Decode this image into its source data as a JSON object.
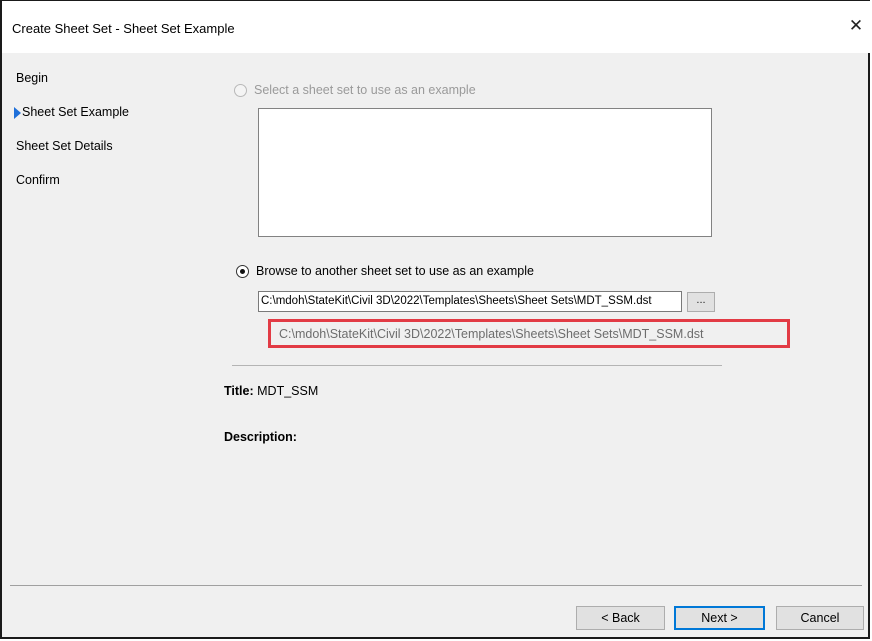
{
  "window": {
    "title": "Create Sheet Set - Sheet Set Example",
    "close_glyph": "✕"
  },
  "steps": [
    {
      "label": "Begin",
      "current": false
    },
    {
      "label": "Sheet Set Example",
      "current": true
    },
    {
      "label": "Sheet Set Details",
      "current": false
    },
    {
      "label": "Confirm",
      "current": false
    }
  ],
  "options": {
    "select_example_label": "Select a sheet set to use as an example",
    "select_example_enabled": false,
    "browse_label": "Browse to another sheet set to use as an example",
    "browse_selected": true
  },
  "browse": {
    "path_value": "C:\\mdoh\\StateKit\\Civil 3D\\2022\\Templates\\Sheets\\Sheet Sets\\MDT_SSM.dst",
    "button_label": "...",
    "full_path": "C:\\mdoh\\StateKit\\Civil 3D\\2022\\Templates\\Sheets\\Sheet Sets\\MDT_SSM.dst",
    "highlight_color": "#e23b45"
  },
  "details": {
    "title_label": "Title:",
    "title_value": "MDT_SSM",
    "description_label": "Description:",
    "description_value": ""
  },
  "buttons": {
    "back": "< Back",
    "next": "Next >",
    "cancel": "Cancel"
  },
  "colors": {
    "accent": "#0078d7",
    "step_arrow": "#1e6fd9"
  },
  "icons": {
    "close": "close-icon",
    "current_step": "triangle-right-icon"
  }
}
